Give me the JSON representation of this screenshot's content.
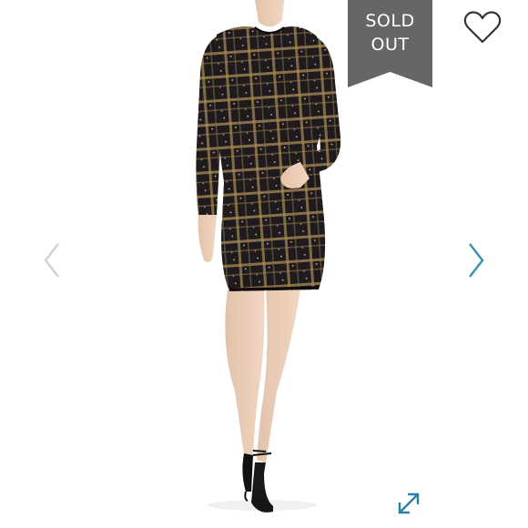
{
  "badge": {
    "line1": "SOLD",
    "line2": "OUT",
    "color": "#666666"
  },
  "icons": {
    "favorite": "heart-outline-icon",
    "prev": "chevron-left-icon",
    "next": "chevron-right-icon",
    "expand": "expand-arrows-icon"
  },
  "colors": {
    "nav_prev": "#d0d0d0",
    "nav_next": "#3a8fb0",
    "expand": "#2a7fa8",
    "heart": "#333333",
    "dress": "#1e1a1d",
    "dress_plaid": "#a98c56"
  }
}
